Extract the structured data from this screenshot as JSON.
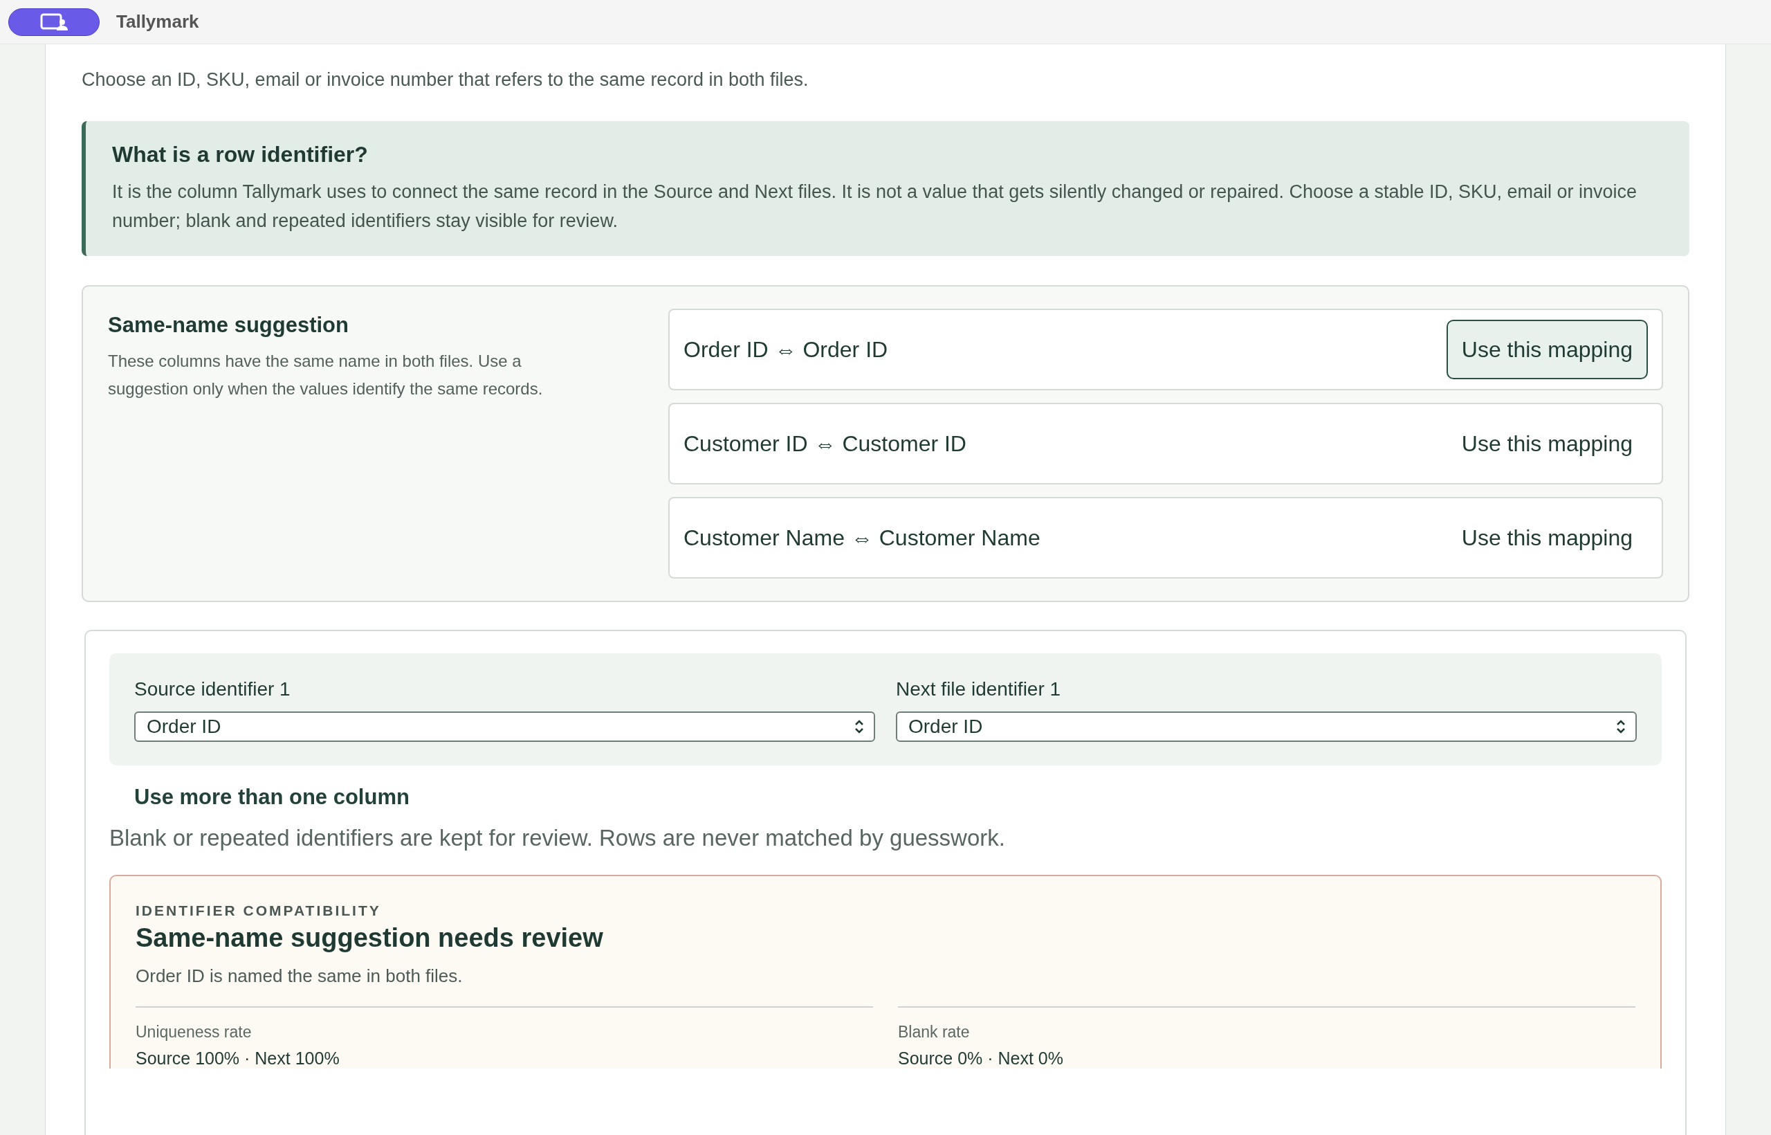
{
  "app_bar": {
    "title": "Tallymark"
  },
  "intro": "Choose an ID, SKU, email or invoice number that refers to the same record in both files.",
  "callout": {
    "title": "What is a row identifier?",
    "body": "It is the column Tallymark uses to connect the same record in the Source and Next files. It is not a value that gets silently changed or repaired. Choose a stable ID, SKU, email or invoice number; blank and repeated identifiers stay visible for review."
  },
  "suggestions": {
    "title": "Same-name suggestion",
    "description": "These columns have the same name in both files. Use a suggestion only when the values identify the same records.",
    "items": [
      {
        "source": "Order ID",
        "arrow": "⇔",
        "next": "Order ID",
        "button": "Use this mapping",
        "selected": true
      },
      {
        "source": "Customer ID",
        "arrow": "⇔",
        "next": "Customer ID",
        "button": "Use this mapping",
        "selected": false
      },
      {
        "source": "Customer Name",
        "arrow": "⇔",
        "next": "Customer Name",
        "button": "Use this mapping",
        "selected": false
      }
    ]
  },
  "identifiers": [
    {
      "label": "Source identifier 1",
      "value": "Order ID"
    },
    {
      "label": "Next file identifier 1",
      "value": "Order ID"
    }
  ],
  "more_columns": "Use more than one column",
  "note": "Blank or repeated identifiers are kept for review. Rows are never matched by guesswork.",
  "review": {
    "eyebrow": "IDENTIFIER COMPATIBILITY",
    "title": "Same-name suggestion needs review",
    "description": "Order ID is named the same in both files.",
    "metrics": [
      {
        "label": "Uniqueness rate",
        "value": "Source 100% · Next 100%"
      },
      {
        "label": "Blank rate",
        "value": "Source 0% · Next 0%"
      }
    ]
  }
}
